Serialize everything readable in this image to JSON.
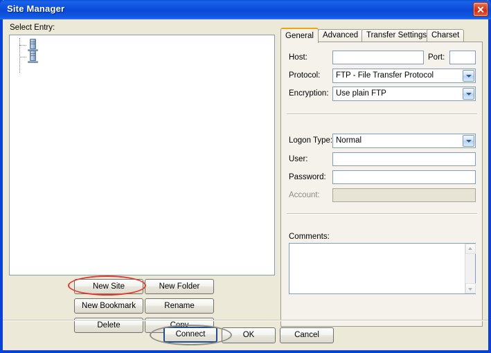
{
  "window": {
    "title": "Site Manager",
    "close_icon": "close-icon",
    "titlebar_color": "#0b4ad9",
    "face_color": "#ece9d8"
  },
  "left": {
    "select_entry_label": "Select Entry:",
    "tree_items": [
      {
        "icon": "server-icon",
        "label": ""
      },
      {
        "icon": "server-icon",
        "label": ""
      }
    ],
    "buttons": [
      {
        "id": "new-site",
        "label": "New Site"
      },
      {
        "id": "new-folder",
        "label": "New Folder"
      },
      {
        "id": "new-bookmark",
        "label": "New Bookmark"
      },
      {
        "id": "rename",
        "label": "Rename"
      },
      {
        "id": "delete",
        "label": "Delete"
      },
      {
        "id": "copy",
        "label": "Copy"
      }
    ]
  },
  "tabs": [
    {
      "id": "general",
      "label": "General",
      "active": true
    },
    {
      "id": "advanced",
      "label": "Advanced",
      "active": false
    },
    {
      "id": "transfer",
      "label": "Transfer Settings",
      "active": false
    },
    {
      "id": "charset",
      "label": "Charset",
      "active": false
    }
  ],
  "general": {
    "host_label": "Host:",
    "host_value": "",
    "port_label": "Port:",
    "port_value": "",
    "protocol_label": "Protocol:",
    "protocol_value": "FTP - File Transfer Protocol",
    "encryption_label": "Encryption:",
    "encryption_value": "Use plain FTP",
    "logon_type_label": "Logon Type:",
    "logon_type_value": "Normal",
    "user_label": "User:",
    "user_value": "",
    "password_label": "Password:",
    "password_value": "",
    "account_label": "Account:",
    "account_value": "",
    "account_disabled": true,
    "comments_label": "Comments:",
    "comments_value": ""
  },
  "footer": {
    "connect_label": "Connect",
    "ok_label": "OK",
    "cancel_label": "Cancel"
  },
  "annotations": [
    {
      "id": "new-site-highlight",
      "shape": "ellipse",
      "color": "#e03a2f"
    },
    {
      "id": "connect-highlight",
      "shape": "ellipse",
      "color": "#8d8d84"
    }
  ]
}
